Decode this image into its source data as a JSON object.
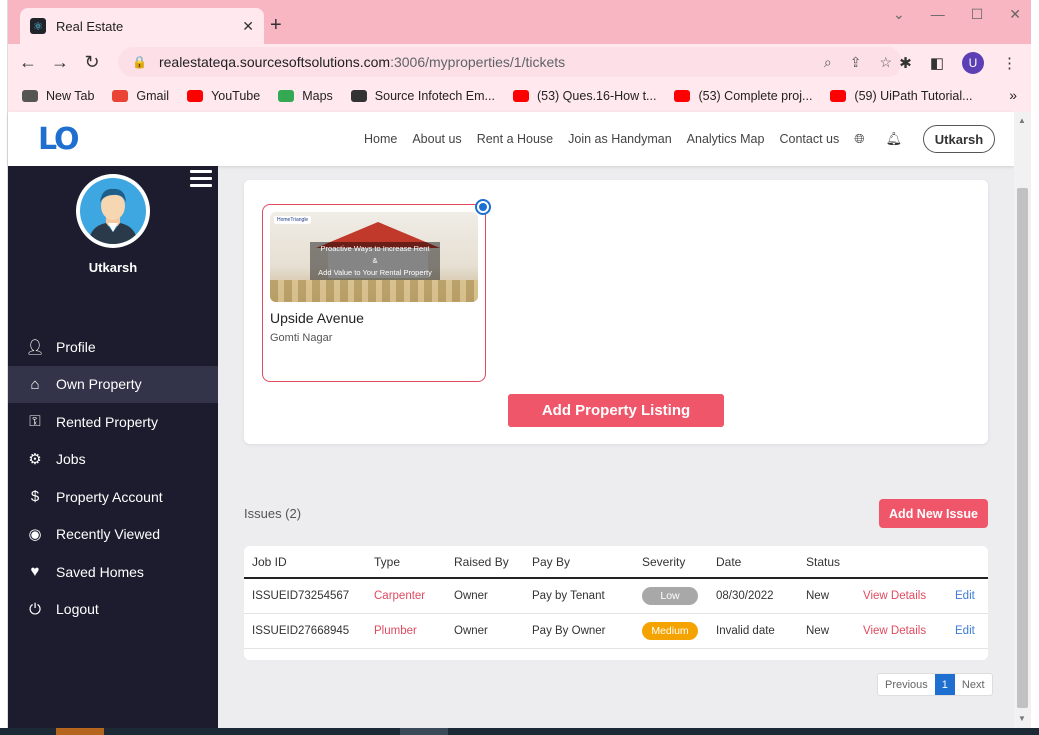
{
  "browser": {
    "tab_title": "Real Estate",
    "tab_close": "✕",
    "new_tab": "+",
    "url_host": "realestateqa.sourcesoftsolutions.com",
    "url_path": ":3006/myproperties/1/tickets",
    "profile_initial": "U",
    "bookmarks": [
      {
        "label": "New Tab",
        "color": "#555555"
      },
      {
        "label": "Gmail",
        "color": "#ea4335"
      },
      {
        "label": "YouTube",
        "color": "#ff0000"
      },
      {
        "label": "Maps",
        "color": "#34a853"
      },
      {
        "label": "Source Infotech Em...",
        "color": "#333333"
      },
      {
        "label": "(53) Ques.16-How t...",
        "color": "#ff0000"
      },
      {
        "label": "(53) Complete proj...",
        "color": "#ff0000"
      },
      {
        "label": "(59) UiPath Tutorial...",
        "color": "#ff0000"
      }
    ],
    "bookmarks_more": "»"
  },
  "header": {
    "logo": "LO",
    "nav": [
      "Home",
      "About us",
      "Rent a House",
      "Join as Handyman",
      "Analytics Map",
      "Contact us"
    ],
    "user_button": "Utkarsh"
  },
  "sidebar": {
    "username": "Utkarsh",
    "items": [
      {
        "label": "Profile",
        "icon": "person-icon"
      },
      {
        "label": "Own Property",
        "icon": "house-hand-icon"
      },
      {
        "label": "Rented Property",
        "icon": "hand-key-icon"
      },
      {
        "label": "Jobs",
        "icon": "users-cog-icon"
      },
      {
        "label": "Property Account",
        "icon": "dollar-icon"
      },
      {
        "label": "Recently Viewed",
        "icon": "eye-icon"
      },
      {
        "label": "Saved Homes",
        "icon": "heart-icon"
      },
      {
        "label": "Logout",
        "icon": "power-icon"
      }
    ],
    "active_index": 1
  },
  "property": {
    "name": "Upside Avenue",
    "location": "Gomti Nagar",
    "image_line1": "Proactive Ways to Increase Rent",
    "image_line2": "&",
    "image_line3": "Add Value to Your Rental Property",
    "image_badge": "HomeTriangle"
  },
  "add_listing_label": "Add Property Listing",
  "issues": {
    "label": "Issues (2)",
    "add_label": "Add New Issue",
    "columns": [
      "Job ID",
      "Type",
      "Raised By",
      "Pay By",
      "Severity",
      "Date",
      "Status",
      "",
      ""
    ],
    "rows": [
      {
        "job_id": "ISSUEID73254567",
        "type": "Carpenter",
        "raised_by": "Owner",
        "pay_by": "Pay by Tenant",
        "severity": "Low",
        "severity_color": "#a8a8a8",
        "date": "08/30/2022",
        "status": "New",
        "view": "View Details",
        "edit": "Edit"
      },
      {
        "job_id": "ISSUEID27668945",
        "type": "Plumber",
        "raised_by": "Owner",
        "pay_by": "Pay By Owner",
        "severity": "Medium",
        "severity_color": "#f5a300",
        "date": "Invalid date",
        "status": "New",
        "view": "View Details",
        "edit": "Edit"
      }
    ]
  },
  "pagination": {
    "previous": "Previous",
    "current": "1",
    "next": "Next"
  },
  "colors": {
    "accent": "#f0566a",
    "sidebar": "#1c1c2e",
    "brand": "#1f6fd1",
    "chrome": "#f8b6c3"
  }
}
